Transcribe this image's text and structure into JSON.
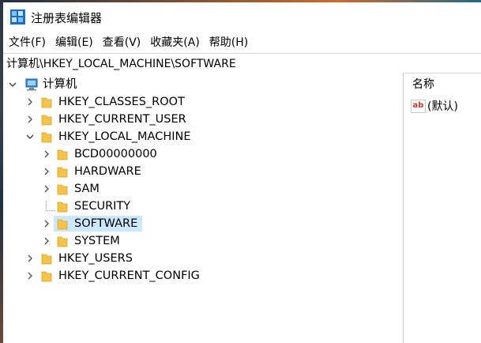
{
  "window": {
    "title": "注册表编辑器"
  },
  "menu": [
    {
      "label": "文件(F)"
    },
    {
      "label": "编辑(E)"
    },
    {
      "label": "查看(V)"
    },
    {
      "label": "收藏夹(A)"
    },
    {
      "label": "帮助(H)"
    }
  ],
  "address": {
    "path": "计算机\\HKEY_LOCAL_MACHINE\\SOFTWARE"
  },
  "tree": {
    "root": {
      "label": "计算机",
      "icon": "computer-icon",
      "expanded": true
    },
    "hives": [
      {
        "label": "HKEY_CLASSES_ROOT",
        "expanded": false
      },
      {
        "label": "HKEY_CURRENT_USER",
        "expanded": false
      },
      {
        "label": "HKEY_LOCAL_MACHINE",
        "expanded": true
      },
      {
        "label": "HKEY_USERS",
        "expanded": false
      },
      {
        "label": "HKEY_CURRENT_CONFIG",
        "expanded": false
      }
    ],
    "hklm_children": [
      {
        "label": "BCD00000000",
        "has_children": true,
        "selected": false
      },
      {
        "label": "HARDWARE",
        "has_children": true,
        "selected": false
      },
      {
        "label": "SAM",
        "has_children": true,
        "selected": false
      },
      {
        "label": "SECURITY",
        "has_children": false,
        "selected": false
      },
      {
        "label": "SOFTWARE",
        "has_children": true,
        "selected": true
      },
      {
        "label": "SYSTEM",
        "has_children": true,
        "selected": false
      }
    ]
  },
  "list": {
    "column_name": "名称",
    "values": [
      {
        "name": "(默认)",
        "icon": "string-value-icon"
      }
    ]
  },
  "colors": {
    "selection": "#cce8ff",
    "folder": "#f3c34b",
    "accent": "#0078d7"
  }
}
